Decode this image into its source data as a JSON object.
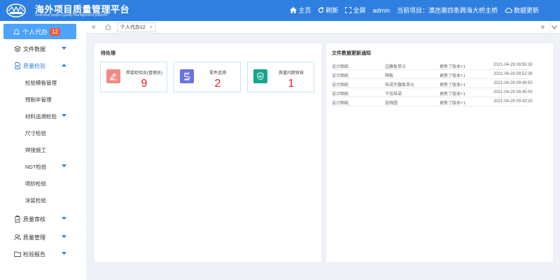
{
  "header": {
    "title": "海外项目质量管理平台",
    "subtitle": "Overseas project quality management platform",
    "nav": [
      {
        "icon": "home-icon",
        "label": "主页"
      },
      {
        "icon": "refresh-icon",
        "label": "刷新"
      },
      {
        "icon": "fullscreen-icon",
        "label": "全屏"
      },
      {
        "icon": "",
        "label": "admin"
      },
      {
        "icon": "",
        "label": "当前项目：澳氹第四条跨海大桥主桥"
      },
      {
        "icon": "cloud-sync-icon",
        "label": "数据更新"
      }
    ]
  },
  "sidebar": {
    "active": {
      "label": "个人代办",
      "badge": "12"
    },
    "items": [
      {
        "label": "文件数据",
        "icon": "layers-icon",
        "caret": "down"
      },
      {
        "label": "质量检验",
        "icon": "document-icon",
        "caret": "up"
      },
      {
        "label": "检验模板管理"
      },
      {
        "label": "预制半管理"
      },
      {
        "label": "材料追溯检验",
        "caret": "down"
      },
      {
        "label": "尺寸检验"
      },
      {
        "label": "焊接施工"
      },
      {
        "label": "NDT检验",
        "caret": "down"
      },
      {
        "label": "喷砂检验"
      },
      {
        "label": "涂装检验"
      },
      {
        "label": "质量审核",
        "icon": "clipboard-icon",
        "caret": "down"
      },
      {
        "label": "质量管理",
        "icon": "users-icon",
        "caret": "down"
      },
      {
        "label": "检验报告",
        "icon": "folder-icon",
        "caret": "down"
      }
    ]
  },
  "tabs": {
    "active": "个人代办12"
  },
  "pending": {
    "title": "待处理",
    "cards": [
      {
        "label": "焊接检验员(管理员)",
        "count": "9",
        "color": "#f08a84",
        "icon": "welder-icon"
      },
      {
        "label": "零件追溯",
        "count": "2",
        "color": "#6a73e0",
        "icon": "part-trace-icon"
      },
      {
        "label": "质量问题审核",
        "count": "1",
        "color": "#17a58a",
        "icon": "shield-check-icon"
      }
    ]
  },
  "notices": {
    "title": "文件数据更新通知",
    "rows": [
      {
        "type": "设计图纸",
        "name": "边腹板单元",
        "action": "更新了版本+1",
        "time": "2021-04-29 09:55:30"
      },
      {
        "type": "设计图纸",
        "name": "隔板",
        "action": "更新了版本+1",
        "time": "2021-04-29 09:52:38"
      },
      {
        "type": "设计图纸",
        "name": "纵梁外腹板单元",
        "action": "更新了版本+1",
        "time": "2021-04-29 09:48:50"
      },
      {
        "type": "设计图纸",
        "name": "下弦纵梁",
        "action": "更新了版本+1",
        "time": "2021-04-29 09:45:00"
      },
      {
        "type": "设计图纸",
        "name": "加强圈",
        "action": "更新了版本+1",
        "time": "2021-04-29 09:43:20"
      }
    ]
  },
  "colors": {
    "brand": "#2f7fe0",
    "active_menu": "#4da3ff",
    "badge": "#e85a3a",
    "count": "#e8212b"
  }
}
